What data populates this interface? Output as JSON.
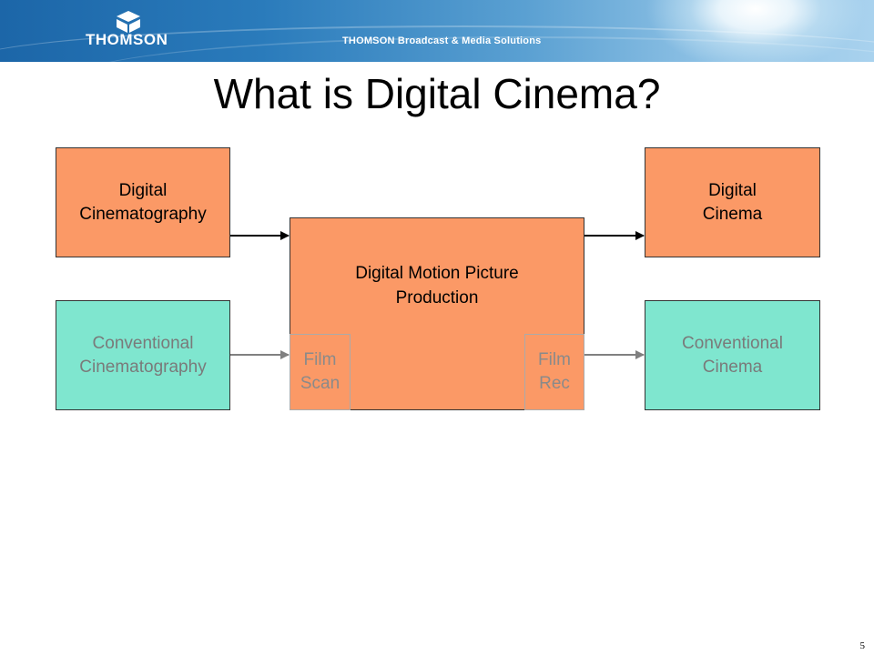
{
  "header": {
    "logo_text": "THOMSON",
    "tagline": "THOMSON Broadcast & Media Solutions"
  },
  "slide": {
    "title": "What is Digital Cinema?",
    "page_number": "5"
  },
  "diagram": {
    "left_top": {
      "line1": "Digital",
      "line2": "Cinematography"
    },
    "left_bottom": {
      "line1": "Conventional",
      "line2": "Cinematography"
    },
    "center": {
      "line1": "Digital Motion Picture",
      "line2": "Production",
      "film_scan": {
        "line1": "Film",
        "line2": "Scan"
      },
      "film_rec": {
        "line1": "Film",
        "line2": "Rec"
      }
    },
    "right_top": {
      "line1": "Digital",
      "line2": "Cinema"
    },
    "right_bottom": {
      "line1": "Conventional",
      "line2": "Cinema"
    }
  },
  "colors": {
    "digital_box": "#fb9966",
    "conventional_box": "#7fe6cf",
    "header_blue": "#2a7bbb"
  }
}
